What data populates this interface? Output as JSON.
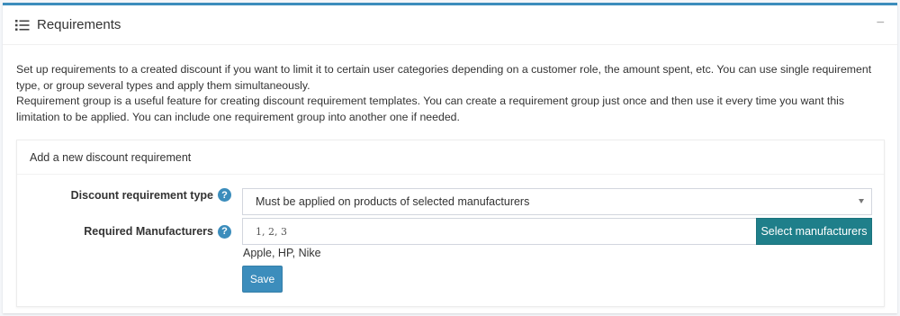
{
  "card": {
    "title": "Requirements",
    "icon": "list-icon",
    "collapse_symbol": "−"
  },
  "description": {
    "line1": "Set up requirements to a created discount if you want to limit it to certain user categories depending on a customer role, the amount spent, etc. You can use single requirement type, or group several types and apply them simultaneously.",
    "line2": "Requirement group is a useful feature for creating discount requirement templates. You can create a requirement group just once and then use it every time you want this limitation to be applied. You can include one requirement group into another one if needed."
  },
  "new_requirement": {
    "header": "Add a new discount requirement",
    "type_label": "Discount requirement type",
    "type_value": "Must be applied on products of selected manufacturers",
    "manufacturers_label": "Required Manufacturers",
    "manufacturers_value": "1, 2, 3",
    "select_button": "Select manufacturers",
    "manufacturer_names": "Apple, HP, Nike",
    "save_button": "Save",
    "help_symbol": "?"
  },
  "colors": {
    "accent": "#3c8dbc",
    "select_button": "#1f7f8a"
  }
}
